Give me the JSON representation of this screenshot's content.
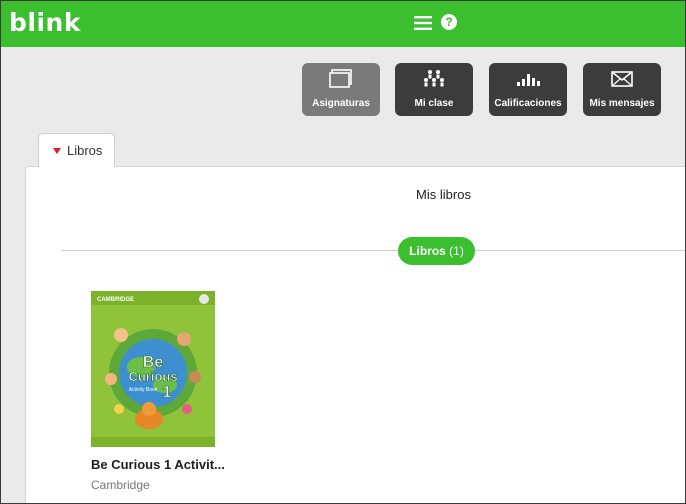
{
  "header": {
    "logo": "blink",
    "help_icon_glyph": "?",
    "bg_color": "#3bbf2f"
  },
  "tiles": [
    {
      "label": "Asignaturas",
      "icon": "screen-icon",
      "active": true
    },
    {
      "label": "Mi clase",
      "icon": "people-icon",
      "active": false
    },
    {
      "label": "Calificaciones",
      "icon": "bars-icon",
      "active": false
    },
    {
      "label": "Mis mensajes",
      "icon": "envelope-icon",
      "active": false
    }
  ],
  "tab": {
    "label": "Libros"
  },
  "main": {
    "title": "Mis libros",
    "pill_label": "Libros",
    "pill_count": "(1)"
  },
  "book": {
    "cover_brand": "CAMBRIDGE",
    "cover_title_line1": "Be",
    "cover_title_line2": "Curious",
    "cover_subtitle": "Activity Book",
    "cover_number": "1",
    "title": "Be Curious 1 Activit...",
    "publisher": "Cambridge"
  }
}
